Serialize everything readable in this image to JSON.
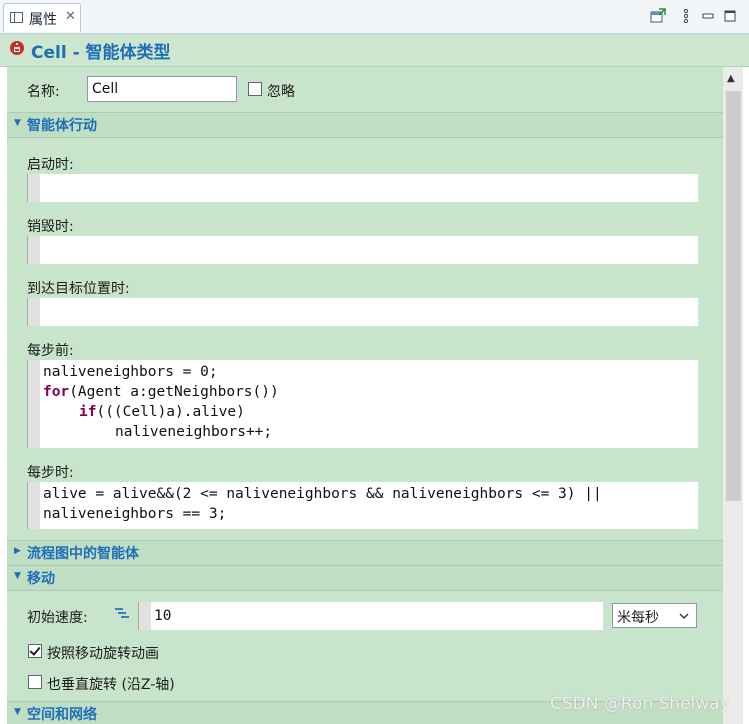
{
  "tab": {
    "label": "属性",
    "close": "✕"
  },
  "header": {
    "title": "Cell - 智能体类型"
  },
  "name_row": {
    "label": "名称:",
    "value": "Cell",
    "ignore_label": "忽略"
  },
  "sections": {
    "agent_actions": "智能体行动",
    "flowchart_agent": "流程图中的智能体",
    "movement": "移动",
    "space_network": "空间和网络"
  },
  "fields": {
    "on_startup": "启动时:",
    "on_destroy": "销毁时:",
    "on_arrival": "到达目标位置时:",
    "on_before_step": "每步前:",
    "on_step": "每步时:"
  },
  "code": {
    "before_step": {
      "line1": "naliveneighbors = 0;",
      "line2_kw": "for",
      "line2_rest": "(Agent a:getNeighbors())",
      "line3_kw": "if",
      "line3_rest": "(((Cell)a).alive)",
      "line4": "naliveneighbors++;"
    },
    "on_step": {
      "line1": "alive = alive&&(2 <= naliveneighbors && naliveneighbors <= 3) ||",
      "line2": "naliveneighbors == 3;"
    }
  },
  "movement": {
    "initial_speed_label": "初始速度:",
    "initial_speed_value": "10",
    "unit": "米每秒",
    "rotate_label": "按照移动旋转动画",
    "rotate_checked": true,
    "vertical_label": "也垂直旋转 (沿Z-轴)",
    "vertical_checked": false
  },
  "watermark": "CSDN @Ron Shelway"
}
